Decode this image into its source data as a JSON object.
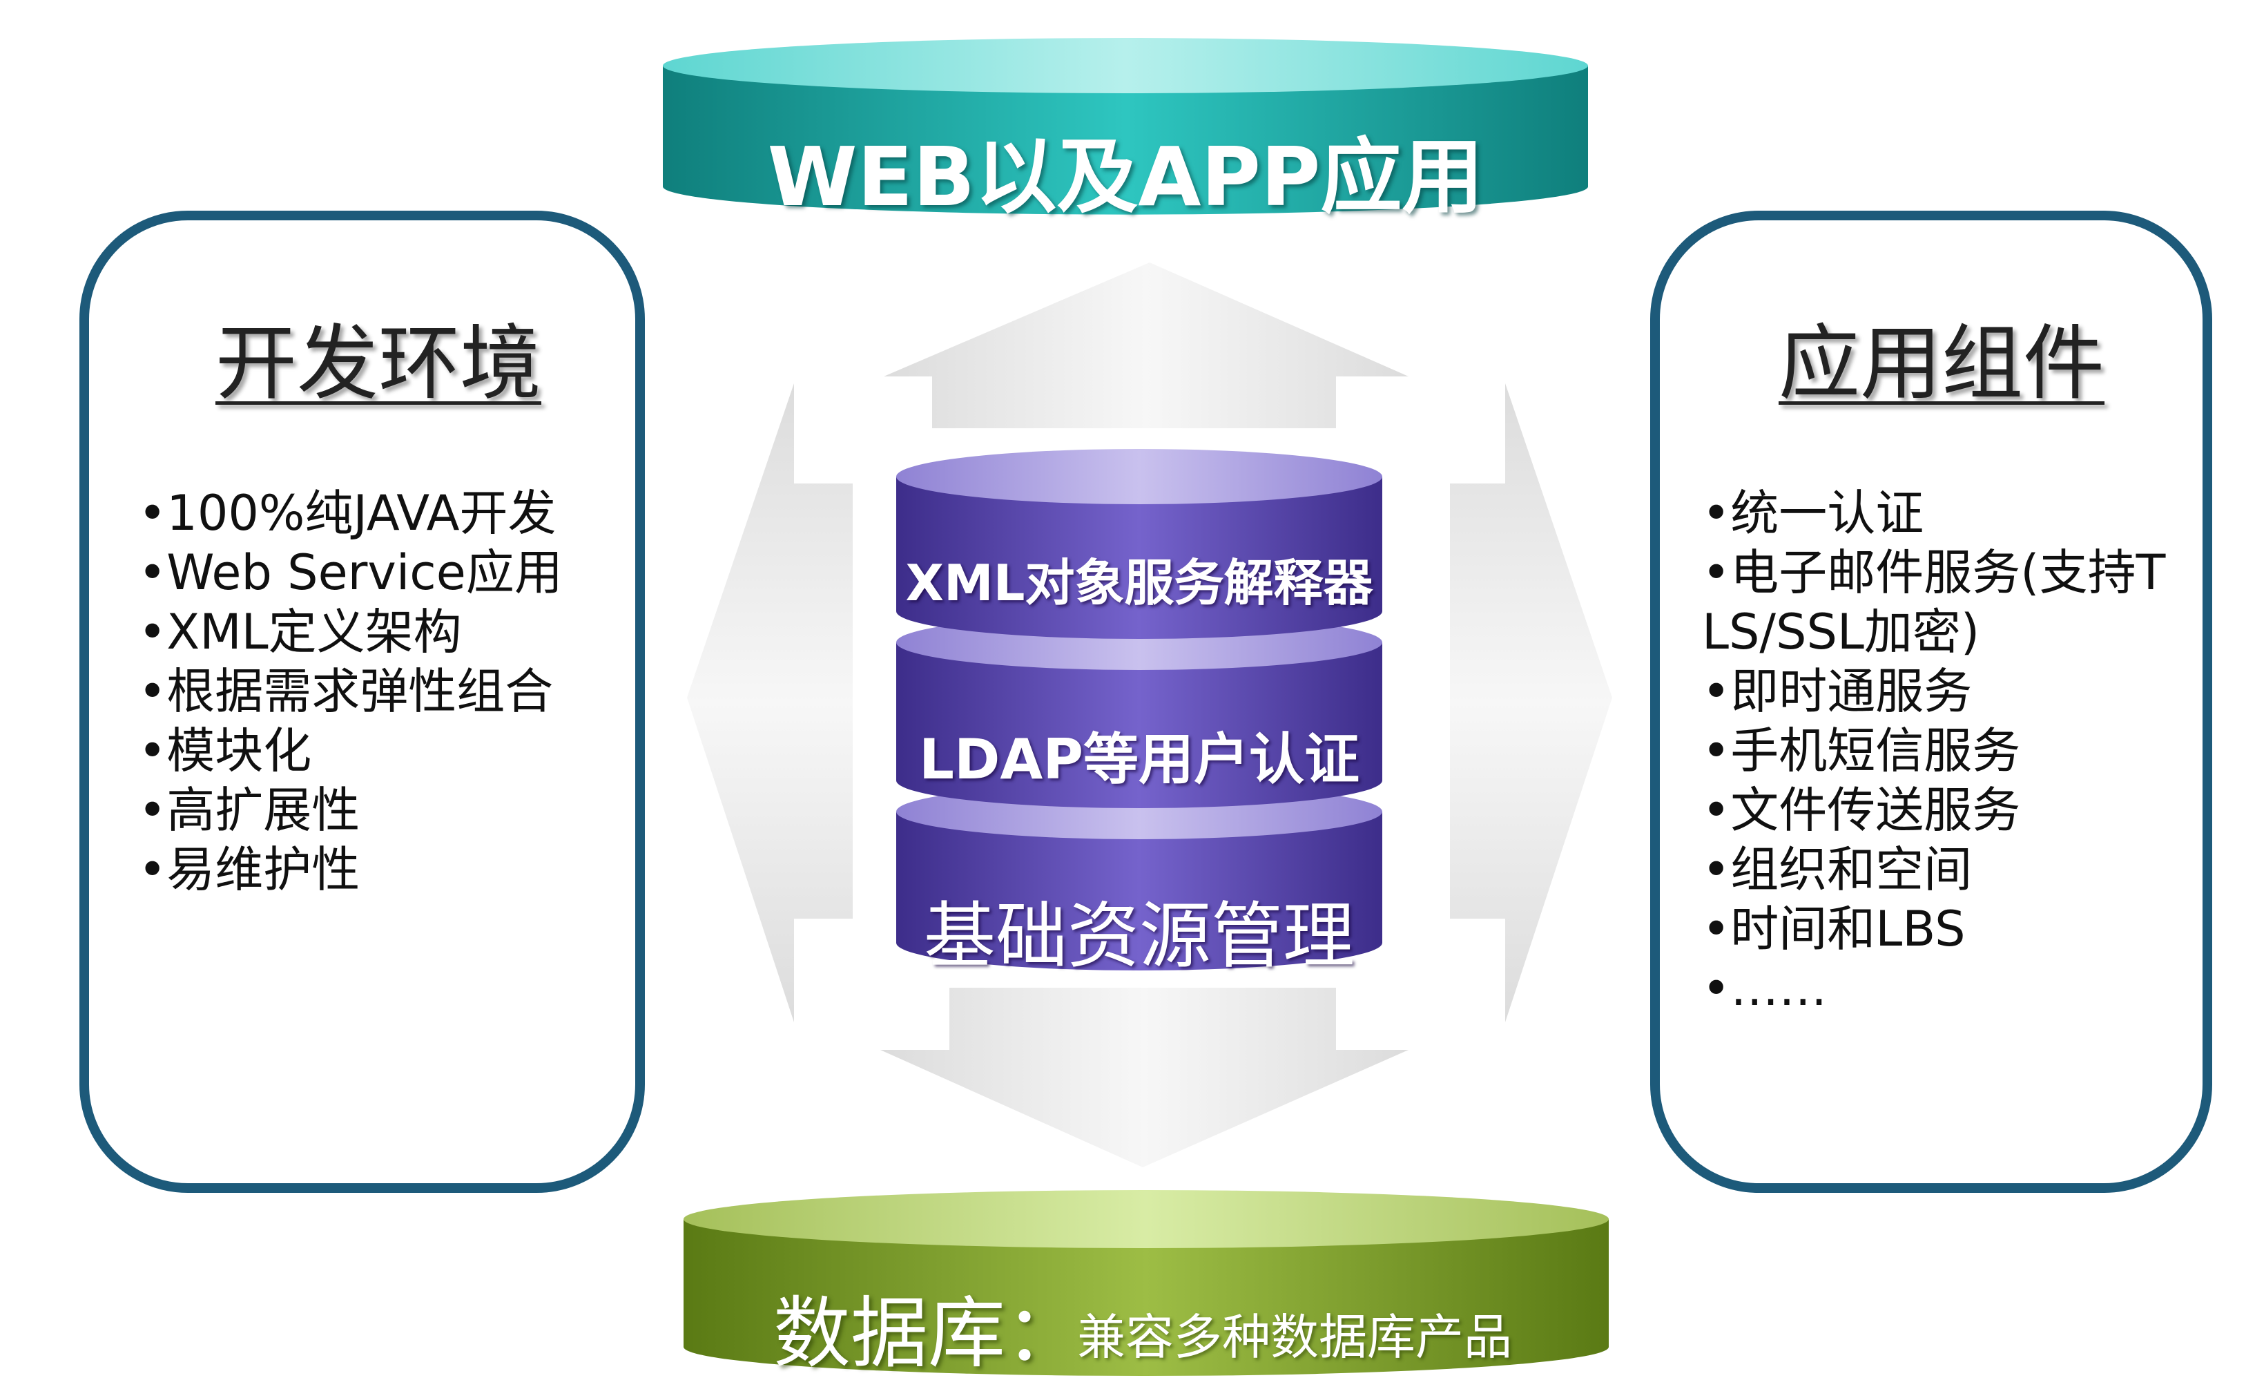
{
  "top_platform": {
    "label": "WEB以及APP应用",
    "color": "#2ec6c0"
  },
  "bottom_platform": {
    "label_main": "数据库：",
    "label_sub": "兼容多种数据库产品",
    "color": "#7e9e2e"
  },
  "left_panel": {
    "title": "开发环境",
    "items": [
      "•100%纯JAVA开发",
      "•Web Service应用",
      "•XML定义架构",
      "•根据需求弹性组合",
      "•模块化",
      "•高扩展性",
      "•易维护性"
    ]
  },
  "right_panel": {
    "title": "应用组件",
    "items": [
      "•统一认证",
      "•电子邮件服务(支持TLS/SSL加密)",
      "•即时通服务",
      "•手机短信服务",
      "•文件传送服务",
      "•组织和空间",
      "•时间和LBS",
      "•……"
    ]
  },
  "center_stack": {
    "layers": [
      "XML对象服务解释器",
      "LDAP等用户认证",
      "基础资源管理"
    ],
    "color": "#5b47b2"
  },
  "panel_border_color": "#1d5a7a"
}
